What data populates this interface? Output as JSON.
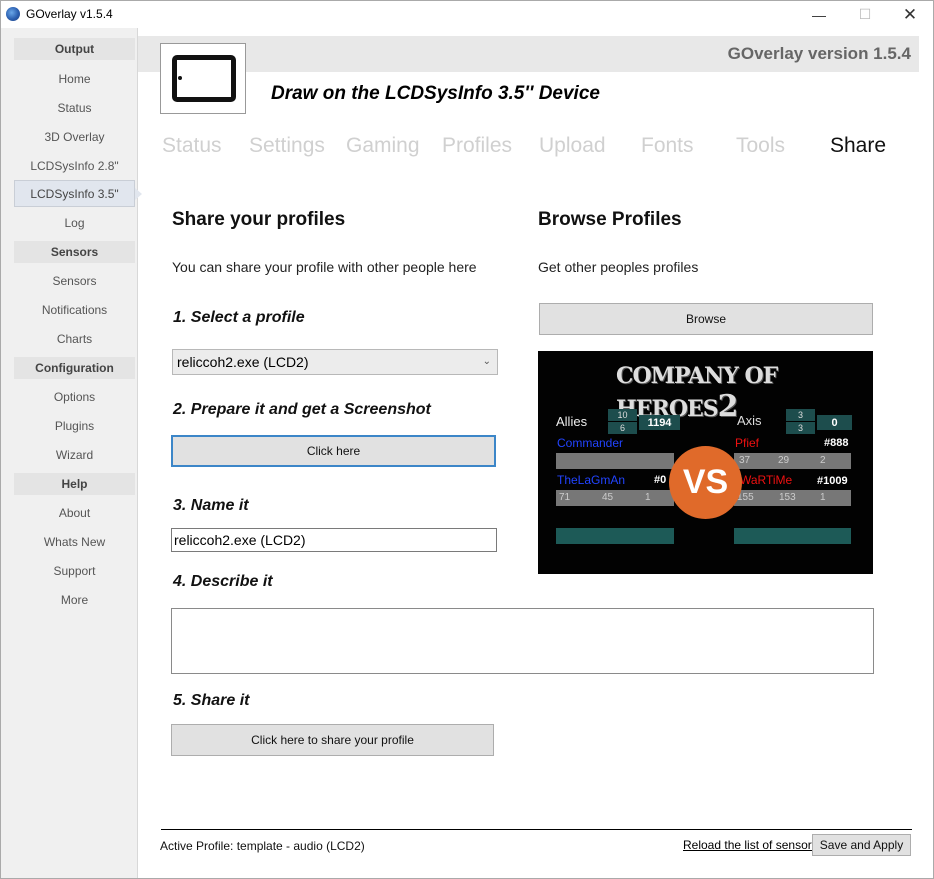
{
  "window": {
    "title": "GOverlay v1.5.4"
  },
  "sidebar": {
    "sections": [
      {
        "header": "Output",
        "items": [
          "Home",
          "Status",
          "3D Overlay",
          "LCDSysInfo 2.8\"",
          "LCDSysInfo 3.5\"",
          "Log"
        ]
      },
      {
        "header": "Sensors",
        "items": [
          "Sensors",
          "Notifications",
          "Charts"
        ]
      },
      {
        "header": "Configuration",
        "items": [
          "Options",
          "Plugins",
          "Wizard"
        ]
      },
      {
        "header": "Help",
        "items": [
          "About",
          "Whats New",
          "Support",
          "More"
        ]
      }
    ],
    "active_item": "LCDSysInfo 3.5\""
  },
  "header": {
    "version": "GOverlay version 1.5.4",
    "device_title": "Draw on the LCDSysInfo 3.5'' Device",
    "device_icon": "tablet-icon"
  },
  "tabs": [
    "Status",
    "Settings",
    "Gaming",
    "Profiles",
    "Upload",
    "Fonts",
    "Tools",
    "Share"
  ],
  "active_tab": "Share",
  "share": {
    "title": "Share your profiles",
    "description": "You can share your profile with other people here",
    "step1": "1. Select a profile",
    "profile_selected": "reliccoh2.exe (LCD2)",
    "step2": "2. Prepare it and get a Screenshot",
    "screenshot_button": "Click here",
    "step3": "3. Name it",
    "name_value": "reliccoh2.exe (LCD2)",
    "step4": "4. Describe it",
    "description_value": "",
    "step5": "5. Share it",
    "share_button": "Click here to share your profile"
  },
  "browse": {
    "title": "Browse Profiles",
    "description": "Get other peoples profiles",
    "browse_button": "Browse"
  },
  "preview": {
    "logo_text": "COMPANY OF HEROES",
    "logo_num": "2",
    "allies_label": "Allies",
    "allies_counts": [
      "10",
      "6"
    ],
    "allies_score": "1194",
    "axis_label": "Axis",
    "axis_counts": [
      "3",
      "3"
    ],
    "axis_score": "0",
    "commander": "Commander",
    "pfief": "Pfief",
    "pfief_rank": "#888",
    "pfief_stats": [
      "37",
      "29",
      "2"
    ],
    "player_left": "TheLaGmAn",
    "player_left_rank": "#0",
    "player_left_stats": [
      "71",
      "45",
      "1"
    ],
    "player_right": "WaRTiMe",
    "player_right_rank": "#1009",
    "player_right_stats": [
      "155",
      "153",
      "1"
    ],
    "vs": "VS",
    "colors": {
      "allies_name": "#2244ff",
      "axis_name": "#ee1111",
      "vs_circle": "#e06a2a",
      "teal": "#1d5a57"
    }
  },
  "footer": {
    "active_profile": "Active Profile: template - audio (LCD2)",
    "reload_link": "Reload the list of sensors",
    "save_button": "Save and Apply"
  }
}
